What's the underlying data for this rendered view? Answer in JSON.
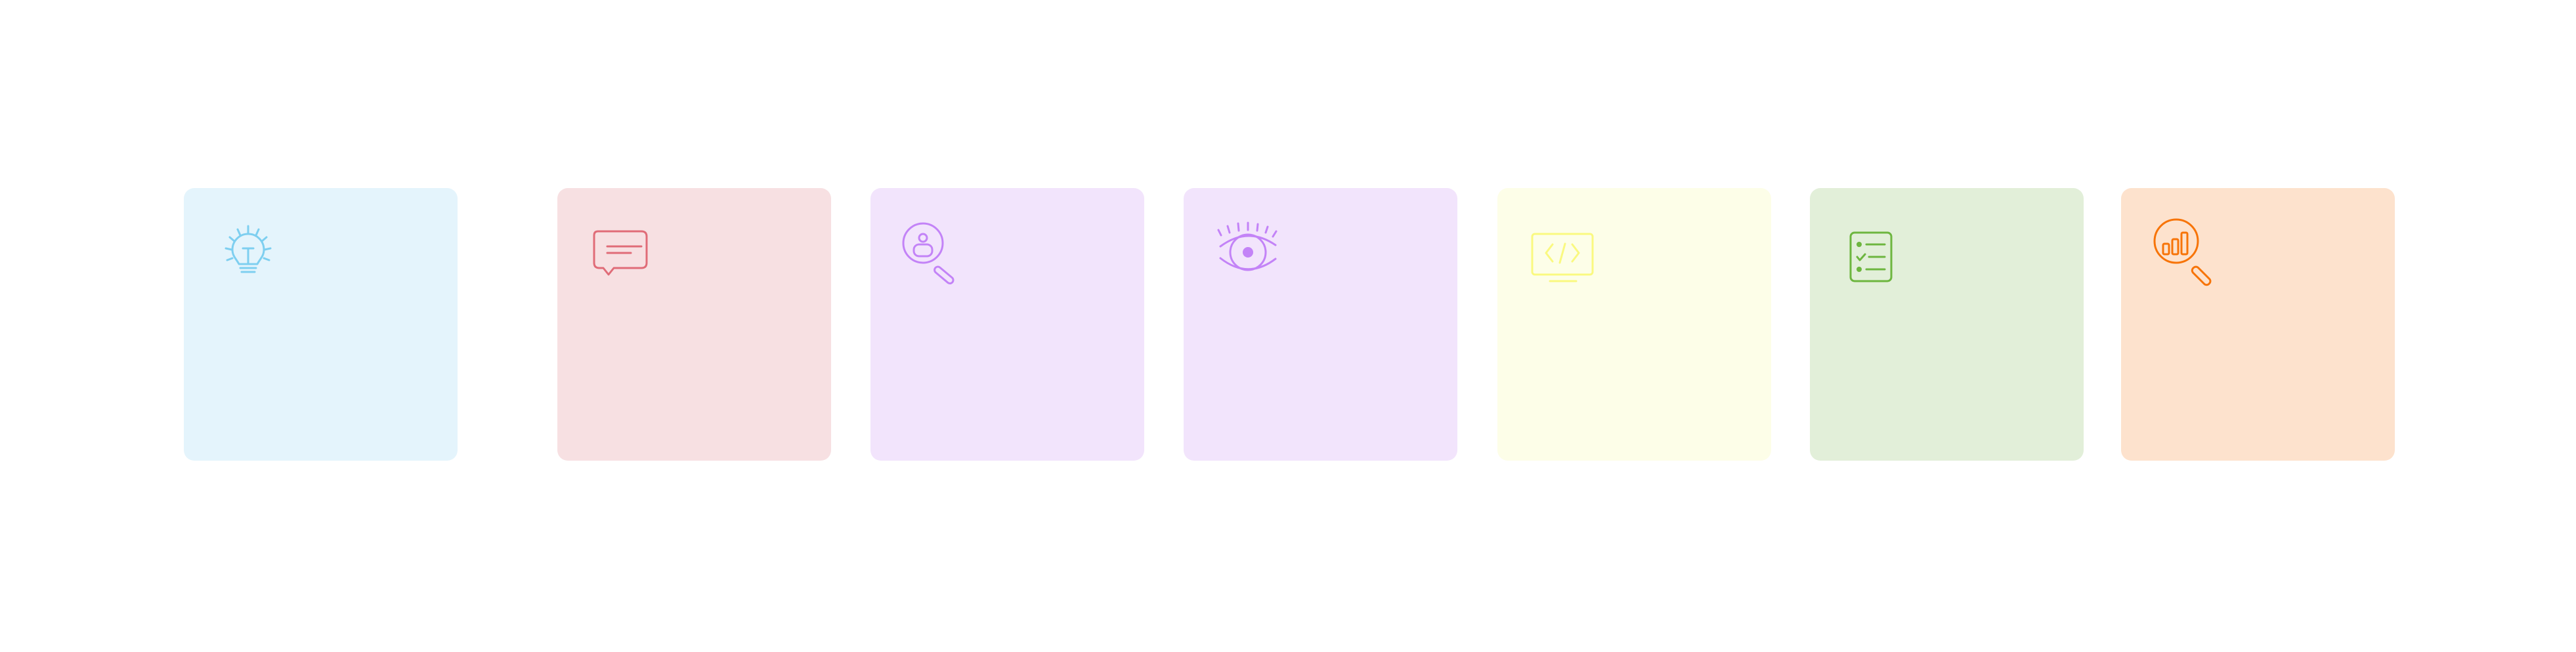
{
  "cards": [
    {
      "icon": "lightbulb-icon",
      "background": "#E4F4FC",
      "accent": "#7ECFF0",
      "label": ""
    },
    {
      "icon": "chat-bubble-icon",
      "background": "#F7E0E2",
      "accent": "#E06C78",
      "label": ""
    },
    {
      "icon": "user-search-icon",
      "background": "#F2E4FC",
      "accent": "#C383F7",
      "label": ""
    },
    {
      "icon": "eye-icon",
      "background": "#F2E4FC",
      "accent": "#C383F7",
      "label": ""
    },
    {
      "icon": "code-monitor-icon",
      "background": "#FDFEE8",
      "accent": "#FAF980",
      "label": ""
    },
    {
      "icon": "checklist-icon",
      "background": "#E2EFD9",
      "accent": "#6DB63F",
      "label": ""
    },
    {
      "icon": "chart-search-icon",
      "background": "#FDE2CD",
      "accent": "#F77408",
      "label": ""
    }
  ]
}
